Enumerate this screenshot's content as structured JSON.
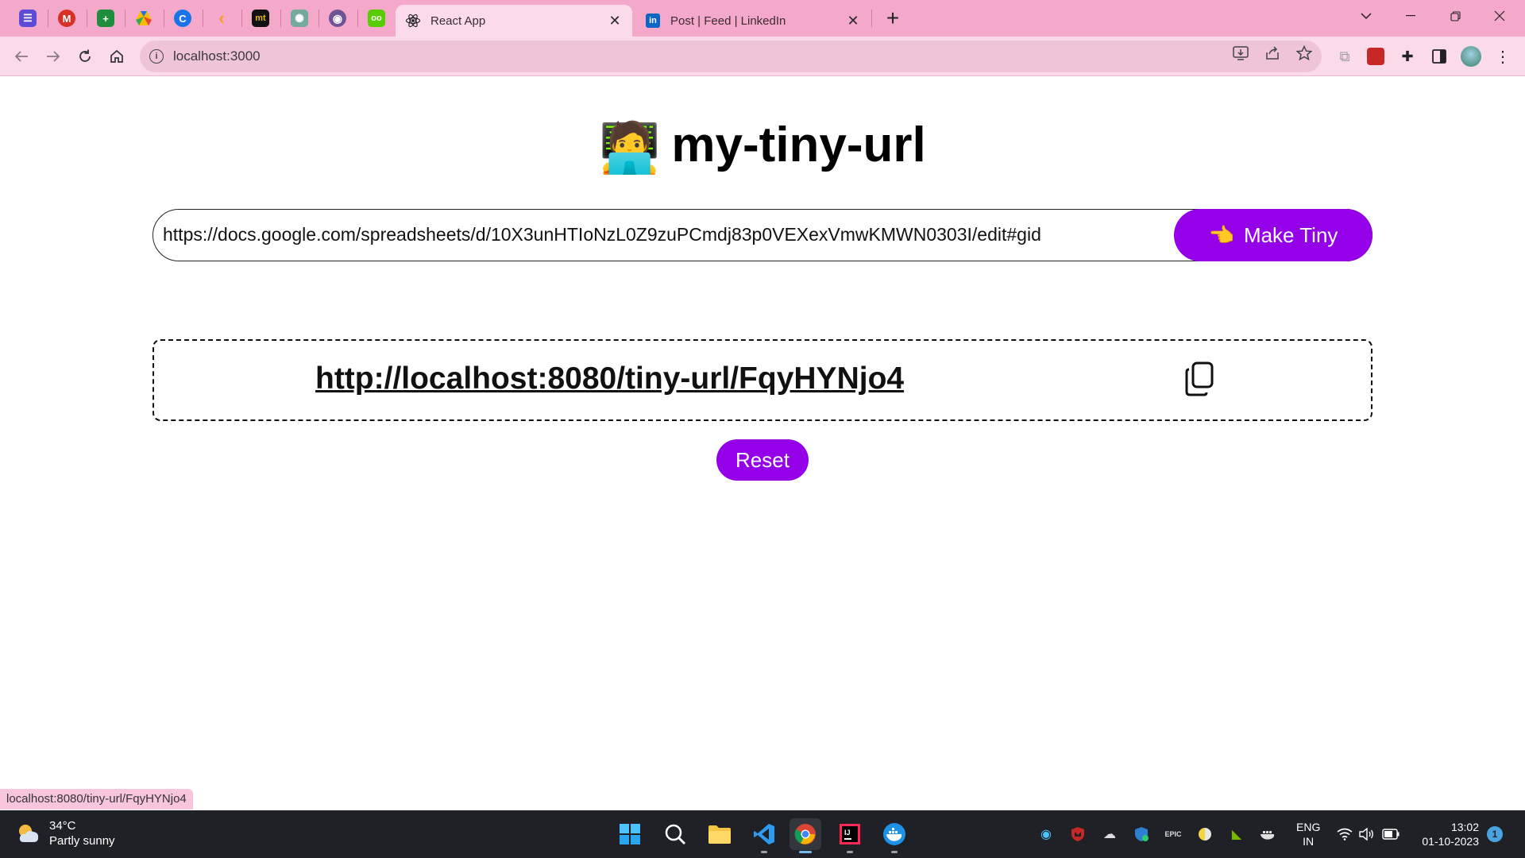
{
  "browser": {
    "pinned_tabs": [
      {
        "icon": "tasks-icon",
        "color": "#5b4bd6",
        "glyph": "☰"
      },
      {
        "icon": "gmail-icon",
        "color": "#d93025",
        "glyph": "M"
      },
      {
        "icon": "sheets-icon",
        "color": "#1e8e3e",
        "glyph": "+"
      },
      {
        "icon": "drive-icon",
        "color": "#f2a600",
        "glyph": "▲"
      },
      {
        "icon": "c-icon",
        "color": "#1a73e8",
        "glyph": "C"
      },
      {
        "icon": "leetcode-icon",
        "color": "#f89f1b",
        "glyph": "‹"
      },
      {
        "icon": "monkeytype-icon",
        "color": "#111111",
        "glyph": "mt"
      },
      {
        "icon": "chatgpt-icon",
        "color": "#74aa9c",
        "glyph": "✺"
      },
      {
        "icon": "github-icon",
        "color": "#6e5494",
        "glyph": "◉"
      },
      {
        "icon": "duolingo-icon",
        "color": "#58cc02",
        "glyph": "oo"
      }
    ],
    "tabs": [
      {
        "label": "React App",
        "active": true
      },
      {
        "label": "Post | Feed | LinkedIn",
        "active": false
      }
    ],
    "address": "localhost:3000",
    "status_url": "localhost:8080/tiny-url/FqyHYNjo4"
  },
  "app": {
    "title": "my-tiny-url",
    "title_emoji": "🧑‍💻",
    "input_value": "https://docs.google.com/spreadsheets/d/10X3unHTIoNzL0Z9zuPCmdj83p0VEXexVmwKMWN0303I/edit#gid",
    "make_tiny_label": "Make Tiny",
    "make_tiny_emoji": "👈",
    "short_url": "http://localhost:8080/tiny-url/FqyHYNjo4",
    "reset_label": "Reset",
    "accent": "#9400e8"
  },
  "taskbar": {
    "temperature": "34°C",
    "weather": "Partly sunny",
    "lang_top": "ENG",
    "lang_bottom": "IN",
    "time": "13:02",
    "date": "01-10-2023",
    "notifications": "1"
  }
}
